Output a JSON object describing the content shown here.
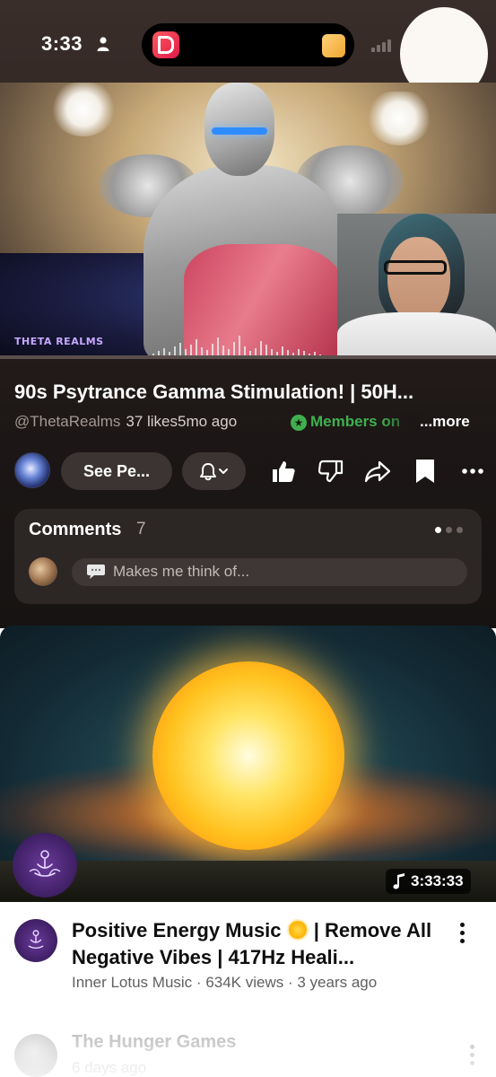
{
  "status_bar": {
    "time": "3:33"
  },
  "player": {
    "watermark": "THETA REALMS",
    "progress": 0.0
  },
  "video": {
    "title": "90s Psytrance Gamma Stimulation! | 50H...",
    "channel": "@ThetaRealms",
    "likes": "37 likes",
    "age": "5mo ago",
    "members_label": "Members on",
    "more_label": "...more"
  },
  "actions": {
    "see_perks_label": "See Pe...",
    "like_icon": "thumbs-up-icon",
    "dislike_icon": "thumbs-down-icon",
    "share_icon": "share-icon",
    "save_icon": "bookmark-icon",
    "more_icon": "more-horizontal-icon"
  },
  "comments": {
    "title": "Comments",
    "count": "7",
    "placeholder": "Makes me think of..."
  },
  "next_video": {
    "title_part1": "Positive Energy Music",
    "title_part2": "| Remove All Negative Vibes | 417Hz Heali...",
    "channel": "Inner Lotus Music",
    "views": "634K views",
    "age": "3 years ago",
    "duration": "3:33:33"
  },
  "third_item": {
    "title": "The Hunger Games",
    "meta": "6 days ago"
  },
  "colors": {
    "dark_bg": "#1c1716",
    "pill_bg": "#3b3432",
    "members_green": "#3fb04e",
    "progress_red": "#ff2a2a",
    "white": "#ffffff"
  }
}
